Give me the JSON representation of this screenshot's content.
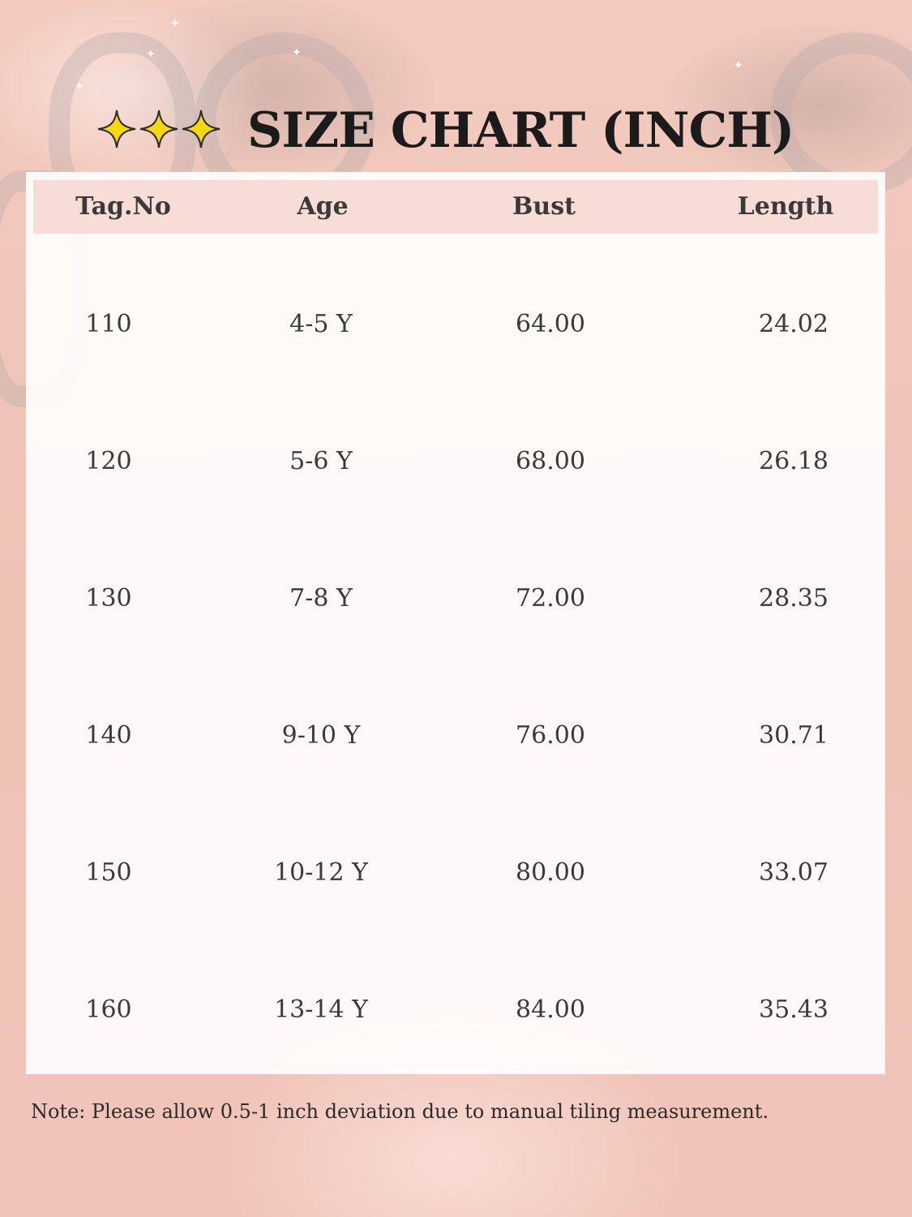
{
  "title": "SIZE CHART (INCH)",
  "title_stars": 3,
  "columns": [
    "Tag.No",
    "Age",
    "Bust",
    "Length"
  ],
  "rows": [
    [
      "110",
      "4-5 Y",
      "64.00",
      "24.02"
    ],
    [
      "120",
      "5-6 Y",
      "68.00",
      "26.18"
    ],
    [
      "130",
      "7-8 Y",
      "72.00",
      "28.35"
    ],
    [
      "140",
      "9-10 Y",
      "76.00",
      "30.71"
    ],
    [
      "150",
      "10-12 Y",
      "80.00",
      "33.07"
    ],
    [
      "160",
      "13-14 Y",
      "84.00",
      "35.43"
    ]
  ],
  "note": "Note: Please allow 0.5-1 inch deviation due to manual tiling measurement.",
  "colors": {
    "background": "#f1c7bb",
    "header_band": "#f8ddd6",
    "star": "#f5d90a",
    "text": "#2f2f2f"
  }
}
